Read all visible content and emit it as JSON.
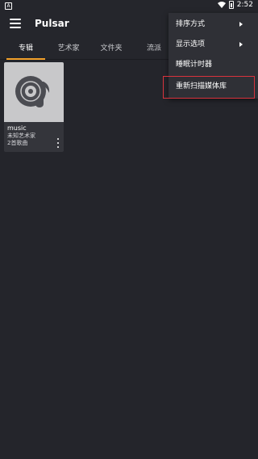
{
  "status_bar": {
    "notification_icon": "A",
    "time": "2:52"
  },
  "toolbar": {
    "menu_icon": "hamburger-icon",
    "title": "Pulsar"
  },
  "tabs": [
    {
      "label": "专辑",
      "active": true
    },
    {
      "label": "艺术家",
      "active": false
    },
    {
      "label": "文件夹",
      "active": false
    },
    {
      "label": "流派",
      "active": false
    }
  ],
  "albums": [
    {
      "name": "music",
      "artist": "未知艺术家",
      "count": "2首歌曲"
    }
  ],
  "menu": {
    "items": [
      {
        "label": "排序方式",
        "has_submenu": true
      },
      {
        "label": "显示选项",
        "has_submenu": true
      },
      {
        "label": "睡眠计时器",
        "has_submenu": false
      },
      {
        "label": "重新扫描媒体库",
        "has_submenu": false,
        "highlighted": true
      }
    ]
  },
  "colors": {
    "accent": "#f2a02a",
    "background": "#24252b",
    "highlight_border": "#d9333d"
  }
}
